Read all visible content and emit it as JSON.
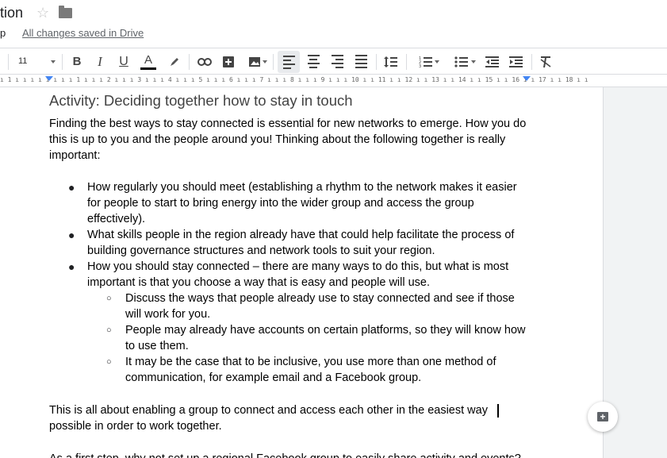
{
  "title_bar": {
    "doc_title": "tion",
    "menu_fragment": "p",
    "save_status": "All changes saved in Drive"
  },
  "toolbar": {
    "font_size": "11",
    "bold": "B",
    "italic": "I",
    "underline": "U",
    "text_color": "A",
    "icons": [
      "highlight-icon",
      "link-icon",
      "add-comment-icon",
      "insert-image-icon",
      "align-left-icon",
      "align-center-icon",
      "align-right-icon",
      "justify-icon",
      "line-spacing-icon",
      "numbered-list-icon",
      "bulleted-list-icon",
      "decrease-indent-icon",
      "increase-indent-icon",
      "clear-formatting-icon"
    ]
  },
  "ruler": {
    "text": "ı 1 ı ı ı ı ı ı ı ı 1 ı ı ı 2 ı ı ı 3 ı ı ı 4 ı ı ı 5 ı ı ı 6 ı ı ı 7 ı ı ı 8 ı ı ı 9 ı ı ı 10 ı ı 11 ı ı 12 ı ı 13 ı ı 14 ı ı 15 ı ı 16 ı ı 17 ı ı 18 ı ı"
  },
  "document": {
    "heading": "Activity: Deciding together how to stay in touch",
    "intro": "Finding the best ways to stay connected is essential for new networks to emerge. How you do this is up to you and the people around you! Thinking about the following together is really important:",
    "bullets": [
      "How regularly you should meet (establishing a rhythm to the network makes it easier for people to start to bring energy into the wider group and access the group effectively).",
      "What skills people in the region already have that could help facilitate the process of building governance structures and network tools to suit your region.",
      "How you should stay connected – there are many ways to do this, but what is most important is that you choose a way that is easy and people will use."
    ],
    "sub_bullets": [
      "Discuss the ways that people already use to stay connected and see if those will work for you.",
      "People may already have accounts on certain platforms, so they will know how to use them.",
      "It may be the case that to be inclusive, you use more than one method of communication, for example email and a Facebook group."
    ],
    "closing": "This is all about enabling a group to connect and access each other in the easiest way possible in order to work together.",
    "last_line": "As a first step, why not set up a regional Facebook group to easily share activity and events?"
  }
}
